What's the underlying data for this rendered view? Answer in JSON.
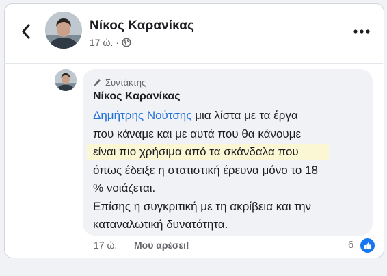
{
  "post": {
    "author": "Νίκος Καρανίκας",
    "time": "17 ώ.",
    "separator": "·",
    "audience_icon": "globe-icon"
  },
  "comment": {
    "role": "Συντάκτης",
    "author": "Νίκος Καρανίκας",
    "mention": "Δημήτρης Νούτσης",
    "lines": [
      " μια λίστα με τα έργα",
      "που κάναμε και με αυτά που θα κάνουμε",
      "είναι πιο χρήσιμα από τα σκάνδαλα που",
      "όπως έδειξε η στατιστική έρευνα μόνο το 18",
      "% νοιάζεται.",
      "Επίσης η συγκριτική με τη ακρίβεια και την",
      "καταναλωτική δυνατότητα."
    ],
    "time": "17 ώ.",
    "like_label": "Μου αρέσει!",
    "reaction_count": "6"
  },
  "colors": {
    "mention": "#216fdb",
    "highlight": "#fbf6d4",
    "like_blue": "#1877f2"
  },
  "icons": [
    "back-arrow-icon",
    "more-options-icon",
    "globe-icon",
    "pencil-icon",
    "thumbs-up-icon"
  ]
}
